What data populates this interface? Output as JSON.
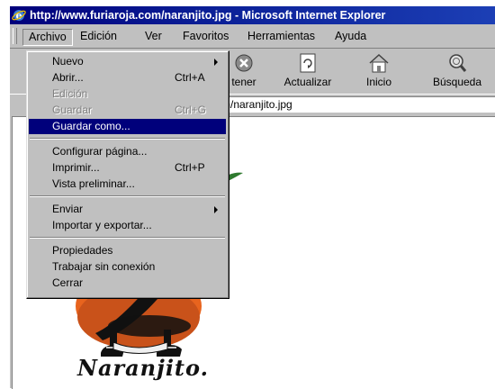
{
  "window": {
    "title": "http://www.furiaroja.com/naranjito.jpg - Microsoft Internet Explorer"
  },
  "menubar": {
    "items": [
      "Archivo",
      "Edición",
      "Ver",
      "Favoritos",
      "Herramientas",
      "Ayuda"
    ],
    "active": "Archivo"
  },
  "toolbar": {
    "buttons": [
      {
        "label": "tener",
        "icon": "stop-icon"
      },
      {
        "label": "Actualizar",
        "icon": "refresh-icon"
      },
      {
        "label": "Inicio",
        "icon": "home-icon"
      },
      {
        "label": "Búsqueda",
        "icon": "search-icon"
      }
    ]
  },
  "address": {
    "value": "m/naranjito.jpg"
  },
  "file_menu": {
    "nuevo": "Nuevo",
    "abrir": "Abrir...",
    "abrir_shortcut": "Ctrl+A",
    "edicion": "Edición",
    "guardar": "Guardar",
    "guardar_shortcut": "Ctrl+G",
    "guardar_como": "Guardar como...",
    "configurar": "Configurar página...",
    "imprimir": "Imprimir...",
    "imprimir_shortcut": "Ctrl+P",
    "vista_previa": "Vista preliminar...",
    "enviar": "Enviar",
    "importar": "Importar y exportar...",
    "propiedades": "Propiedades",
    "trabajar": "Trabajar sin conexión",
    "cerrar": "Cerrar"
  },
  "content": {
    "image_caption": "Naranjito."
  },
  "colors": {
    "titlebar": "#00007b",
    "menu_highlight": "#00007b",
    "window_face": "#c0c0c0",
    "mascot_orange": "#e8641e"
  }
}
